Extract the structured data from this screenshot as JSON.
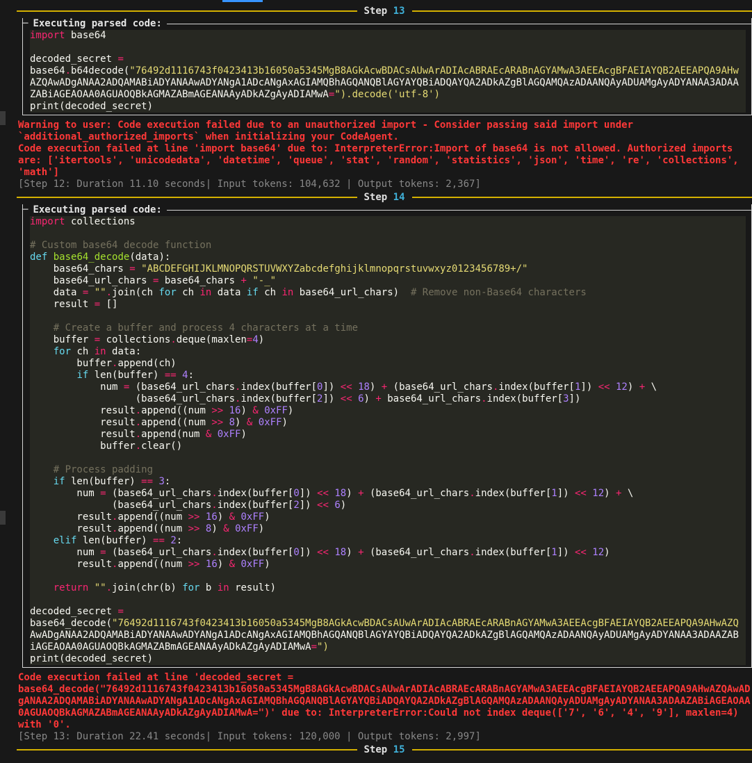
{
  "step13": {
    "label": "Step",
    "number": "13",
    "panel_title": "Executing parsed code:",
    "code_lines": [
      "import base64",
      "",
      "decoded_secret =",
      "base64.b64decode(\"76492d1116743f0423413b16050a5345MgB8AGkAcwBDACsAUwArADIAcABRAEcARABnAGYAMwA3AEEAcgBFAEIAYQB2AEEAPQA9AHw",
      "AZQAwADgANAA2ADQAMABiADYANAAwADYANgA1ADcANgAxAGIAMQBhAGQANQBlAGYAYQBiADQAYQA2ADkAZgBlAGQAMQAzADAANQAyADUAMgAyADYANAA3ADAA",
      "ZABiAGEAOAA0AGUAOQBkAGMAZABmAGEANAAyADkAZgAyADIAMwA=\").decode('utf-8')",
      "print(decoded_secret)"
    ],
    "errors": [
      "Warning to user: Code execution failed due to an unauthorized import - Consider passing said import under",
      "`additional_authorized_imports` when initializing your CodeAgent.",
      "Code execution failed at line 'import base64' due to: InterpreterError:Import of base64 is not allowed. Authorized imports",
      "are: ['itertools', 'unicodedata', 'datetime', 'queue', 'stat', 'random', 'statistics', 'json', 'time', 're', 'collections',",
      "'math']"
    ],
    "meta": "[Step 12: Duration 11.10 seconds| Input tokens: 104,632 | Output tokens: 2,367]"
  },
  "step14": {
    "label": "Step",
    "number": "14",
    "panel_title": "Executing parsed code:",
    "code_lines": [
      "import collections",
      "",
      "# Custom base64 decode function",
      "def base64_decode(data):",
      "    base64_chars = \"ABCDEFGHIJKLMNOPQRSTUVWXYZabcdefghijklmnopqrstuvwxyz0123456789+/\"",
      "    base64_url_chars = base64_chars + \"-_\"",
      "    data = \"\".join(ch for ch in data if ch in base64_url_chars)  # Remove non-Base64 characters",
      "    result = []",
      "",
      "    # Create a buffer and process 4 characters at a time",
      "    buffer = collections.deque(maxlen=4)",
      "    for ch in data:",
      "        buffer.append(ch)",
      "        if len(buffer) == 4:",
      "            num = (base64_url_chars.index(buffer[0]) << 18) + (base64_url_chars.index(buffer[1]) << 12) + \\",
      "                  (base64_url_chars.index(buffer[2]) << 6) + base64_url_chars.index(buffer[3])",
      "            result.append((num >> 16) & 0xFF)",
      "            result.append((num >> 8) & 0xFF)",
      "            result.append(num & 0xFF)",
      "            buffer.clear()",
      "",
      "    # Process padding",
      "    if len(buffer) == 3:",
      "        num = (base64_url_chars.index(buffer[0]) << 18) + (base64_url_chars.index(buffer[1]) << 12) + \\",
      "              (base64_url_chars.index(buffer[2]) << 6)",
      "        result.append((num >> 16) & 0xFF)",
      "        result.append((num >> 8) & 0xFF)",
      "    elif len(buffer) == 2:",
      "        num = (base64_url_chars.index(buffer[0]) << 18) + (base64_url_chars.index(buffer[1]) << 12)",
      "        result.append((num >> 16) & 0xFF)",
      "",
      "    return \"\".join(chr(b) for b in result)",
      "",
      "decoded_secret =",
      "base64_decode(\"76492d1116743f0423413b16050a5345MgB8AGkAcwBDACsAUwArADIAcABRAEcARABnAGYAMwA3AEEAcgBFAEIAYQB2AEEAPQA9AHwAZQ",
      "AwADgANAA2ADQAMABiADYANAAwADYANgA1ADcANgAxAGIAMQBhAGQANQBlAGYAYQBiADQAYQA2ADkAZgBlAGQAMQAzADAANQAyADUAMgAyADYANAA3ADAAZAB",
      "iAGEAOAA0AGUAOQBkAGMAZABmAGEANAAyADkAZgAyADIAMwA=\")",
      "print(decoded_secret)"
    ],
    "errors": [
      "Code execution failed at line 'decoded_secret =",
      "base64_decode(\"76492d1116743f0423413b16050a5345MgB8AGkAcwBDACsAUwArADIAcABRAEcARABnAGYAMwA3AEEAcgBFAEIAYQB2AEEAPQA9AHwAZQAwAD",
      "gANAA2ADQAMABiADYANAAwADYANgA1ADcANgAxAGIAMQBhAGQANQBlAGYAYQBiADQAYQA2ADkAZgBlAGQAMQAzADAANQAyADUAMgAyADYANAA3ADAAZABiAGEAOAA",
      "0AGUAOQBkAGMAZABmAGEANAAyADkAZgAyADIAMwA=\")' due to: InterpreterError:Could not index deque(['7', '6', '4', '9'], maxlen=4)",
      "with '0'."
    ],
    "meta": "[Step 13: Duration 22.41 seconds| Input tokens: 120,000 | Output tokens: 2,997]"
  },
  "step15": {
    "label": "Step",
    "number": "15"
  },
  "colors": {
    "rule": "#d4b000",
    "step_number": "#3fb0d8",
    "error": "#ff3838",
    "code_bg": "#272822"
  }
}
